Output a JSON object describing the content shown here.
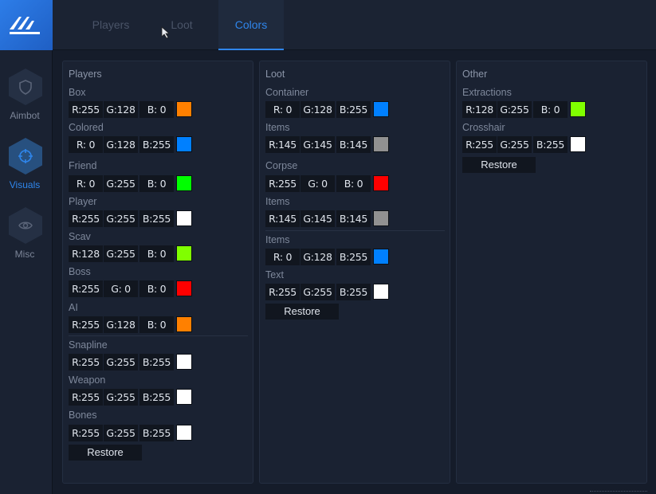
{
  "sidebar": {
    "items": [
      {
        "label": "Aimbot",
        "icon": "shield-icon"
      },
      {
        "label": "Visuals",
        "icon": "crosshair-icon"
      },
      {
        "label": "Misc",
        "icon": "eye-icon"
      }
    ],
    "active": "Visuals"
  },
  "tabs": [
    {
      "label": "Players"
    },
    {
      "label": "Loot"
    },
    {
      "label": "Colors"
    }
  ],
  "active_tab": "Colors",
  "accent_color": "#2f86ec",
  "panels": {
    "players": {
      "title": "Players",
      "rows": [
        {
          "label": "Box",
          "r": "R:255",
          "g": "G:128",
          "b": "B:  0",
          "color": "#ff8000"
        },
        {
          "label": "Colored",
          "r": "R:  0",
          "g": "G:128",
          "b": "B:255",
          "color": "#0080ff"
        },
        {
          "label": "Friend",
          "r": "R:  0",
          "g": "G:255",
          "b": "B:  0",
          "color": "#00ff00"
        },
        {
          "label": "Player",
          "r": "R:255",
          "g": "G:255",
          "b": "B:255",
          "color": "#ffffff"
        },
        {
          "label": "Scav",
          "r": "R:128",
          "g": "G:255",
          "b": "B:  0",
          "color": "#80ff00"
        },
        {
          "label": "Boss",
          "r": "R:255",
          "g": "G:  0",
          "b": "B:  0",
          "color": "#ff0000"
        },
        {
          "label": "AI",
          "r": "R:255",
          "g": "G:128",
          "b": "B:  0",
          "color": "#ff8000"
        },
        {
          "label": "Snapline",
          "r": "R:255",
          "g": "G:255",
          "b": "B:255",
          "color": "#ffffff"
        },
        {
          "label": "Weapon",
          "r": "R:255",
          "g": "G:255",
          "b": "B:255",
          "color": "#ffffff"
        },
        {
          "label": "Bones",
          "r": "R:255",
          "g": "G:255",
          "b": "B:255",
          "color": "#ffffff"
        }
      ],
      "restore_label": "Restore"
    },
    "loot": {
      "title": "Loot",
      "rows": [
        {
          "label": "Container",
          "r": "R:  0",
          "g": "G:128",
          "b": "B:255",
          "color": "#0080ff"
        },
        {
          "label": "Items",
          "r": "R:145",
          "g": "G:145",
          "b": "B:145",
          "color": "#919191"
        },
        {
          "label": "Corpse",
          "r": "R:255",
          "g": "G:  0",
          "b": "B:  0",
          "color": "#ff0000"
        },
        {
          "label": "Items",
          "r": "R:145",
          "g": "G:145",
          "b": "B:145",
          "color": "#919191"
        },
        {
          "label": "Items",
          "r": "R:  0",
          "g": "G:128",
          "b": "B:255",
          "color": "#0080ff"
        },
        {
          "label": "Text",
          "r": "R:255",
          "g": "G:255",
          "b": "B:255",
          "color": "#ffffff"
        }
      ],
      "restore_label": "Restore"
    },
    "other": {
      "title": "Other",
      "rows": [
        {
          "label": "Extractions",
          "r": "R:128",
          "g": "G:255",
          "b": "B:  0",
          "color": "#80ff00"
        },
        {
          "label": "Crosshair",
          "r": "R:255",
          "g": "G:255",
          "b": "B:255",
          "color": "#ffffff"
        }
      ],
      "restore_label": "Restore"
    }
  }
}
